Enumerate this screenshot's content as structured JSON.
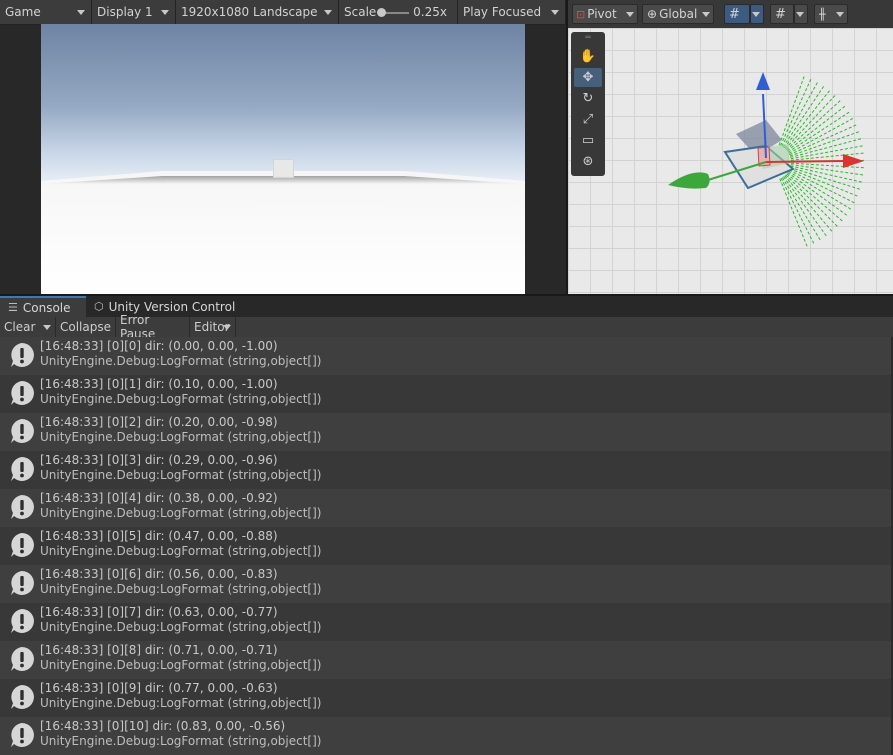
{
  "game_toolbar": {
    "tab": "Game",
    "display": "Display 1",
    "resolution": "1920x1080 Landscape",
    "scale_label": "Scale",
    "scale_value": "0.25x",
    "play_mode": "Play Focused"
  },
  "scene_toolbar": {
    "pivot": "Pivot",
    "global": "Global"
  },
  "console_tabs": {
    "console": "Console",
    "version_control": "Unity Version Control"
  },
  "console_toolbar": {
    "clear": "Clear",
    "collapse": "Collapse",
    "error_pause": "Error Pause",
    "editor": "Editor"
  },
  "logs": [
    {
      "line1": "[16:48:33] [0][0] dir: (0.00, 0.00, -1.00)",
      "line2": "UnityEngine.Debug:LogFormat (string,object[])"
    },
    {
      "line1": "[16:48:33] [0][1] dir: (0.10, 0.00, -1.00)",
      "line2": "UnityEngine.Debug:LogFormat (string,object[])"
    },
    {
      "line1": "[16:48:33] [0][2] dir: (0.20, 0.00, -0.98)",
      "line2": "UnityEngine.Debug:LogFormat (string,object[])"
    },
    {
      "line1": "[16:48:33] [0][3] dir: (0.29, 0.00, -0.96)",
      "line2": "UnityEngine.Debug:LogFormat (string,object[])"
    },
    {
      "line1": "[16:48:33] [0][4] dir: (0.38, 0.00, -0.92)",
      "line2": "UnityEngine.Debug:LogFormat (string,object[])"
    },
    {
      "line1": "[16:48:33] [0][5] dir: (0.47, 0.00, -0.88)",
      "line2": "UnityEngine.Debug:LogFormat (string,object[])"
    },
    {
      "line1": "[16:48:33] [0][6] dir: (0.56, 0.00, -0.83)",
      "line2": "UnityEngine.Debug:LogFormat (string,object[])"
    },
    {
      "line1": "[16:48:33] [0][7] dir: (0.63, 0.00, -0.77)",
      "line2": "UnityEngine.Debug:LogFormat (string,object[])"
    },
    {
      "line1": "[16:48:33] [0][8] dir: (0.71, 0.00, -0.71)",
      "line2": "UnityEngine.Debug:LogFormat (string,object[])"
    },
    {
      "line1": "[16:48:33] [0][9] dir: (0.77, 0.00, -0.63)",
      "line2": "UnityEngine.Debug:LogFormat (string,object[])"
    },
    {
      "line1": "[16:48:33] [0][10] dir: (0.83, 0.00, -0.56)",
      "line2": "UnityEngine.Debug:LogFormat (string,object[])"
    }
  ],
  "icons": {
    "log_entry": "warning-icon",
    "scene_tools": [
      "hand-icon",
      "move-icon",
      "rotate-icon",
      "scale-icon",
      "rect-icon",
      "transform-icon"
    ]
  },
  "colors": {
    "accent": "#3a79bb",
    "axis_x": "#e03030",
    "axis_y": "#2f5fd8",
    "axis_z": "#3aa83a",
    "debug_rays": "#22c022"
  }
}
